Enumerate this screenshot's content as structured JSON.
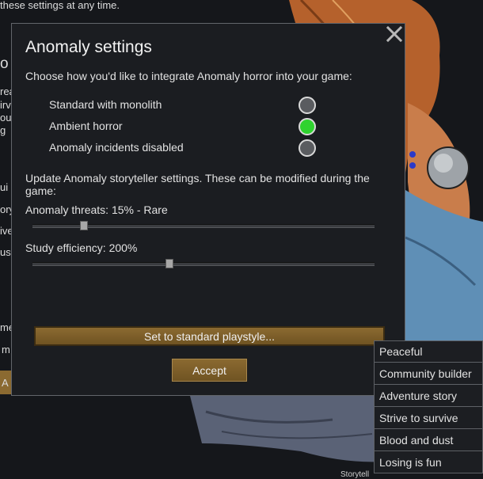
{
  "background": {
    "top_text": "these settings at any time.",
    "side_fragments": [
      "o",
      "rea",
      "irv",
      "ou",
      "g",
      "ui",
      "ory",
      "ive",
      "ust",
      "me",
      "m",
      "A"
    ],
    "footer_fragment": "Storytell"
  },
  "dialog": {
    "title": "Anomaly settings",
    "description": "Choose how you'd like to integrate Anomaly horror into your game:",
    "options": [
      {
        "label": "Standard with monolith",
        "selected": false
      },
      {
        "label": "Ambient horror",
        "selected": true
      },
      {
        "label": "Anomaly incidents disabled",
        "selected": false
      }
    ],
    "update_text": "Update Anomaly storyteller settings. These can be modified during the game:",
    "sliders": [
      {
        "label": "Anomaly threats: 15% - Rare",
        "value": 0.15
      },
      {
        "label": "Study efficiency: 200%",
        "value": 0.4
      }
    ],
    "playstyle_button": "Set to standard playstyle...",
    "accept_button": "Accept",
    "colors": {
      "selected_radio": "#2fd32f",
      "button_brown": "#7a5c28"
    }
  },
  "storyteller_menu": {
    "items": [
      "Peaceful",
      "Community builder",
      "Adventure story",
      "Strive to survive",
      "Blood and dust",
      "Losing is fun"
    ]
  }
}
